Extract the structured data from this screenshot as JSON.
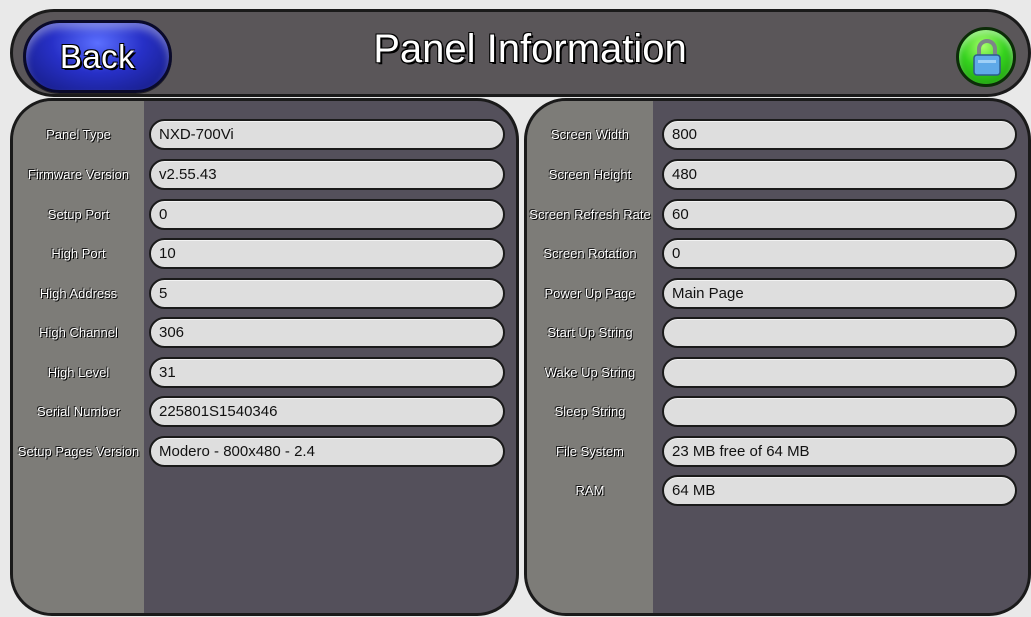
{
  "header": {
    "back_label": "Back",
    "title": "Panel Information",
    "lock_icon": "lock-icon"
  },
  "left_panel": {
    "rows": [
      {
        "label": "Panel Type",
        "value": "NXD-700Vi"
      },
      {
        "label": "Firmware Version",
        "value": "v2.55.43"
      },
      {
        "label": "Setup Port",
        "value": "0"
      },
      {
        "label": "High Port",
        "value": "10"
      },
      {
        "label": "High Address",
        "value": "5"
      },
      {
        "label": "High Channel",
        "value": "306"
      },
      {
        "label": "High Level",
        "value": "31"
      },
      {
        "label": "Serial Number",
        "value": "225801S1540346"
      },
      {
        "label": "Setup Pages Version",
        "value": "Modero - 800x480 - 2.4"
      }
    ]
  },
  "right_panel": {
    "rows": [
      {
        "label": "Screen Width",
        "value": "800"
      },
      {
        "label": "Screen Height",
        "value": "480"
      },
      {
        "label": "Screen Refresh Rate",
        "value": "60"
      },
      {
        "label": "Screen Rotation",
        "value": "0"
      },
      {
        "label": "Power Up Page",
        "value": "Main Page"
      },
      {
        "label": "Start Up String",
        "value": ""
      },
      {
        "label": "Wake Up String",
        "value": ""
      },
      {
        "label": "Sleep String",
        "value": ""
      },
      {
        "label": "File System",
        "value": "23 MB free of 64 MB"
      },
      {
        "label": "RAM",
        "value": "64 MB"
      }
    ]
  },
  "colors": {
    "back_button": "#2730c7",
    "lock_button": "#35d21e",
    "header_bg": "#5a5659",
    "panel_bg": "#54505b",
    "label_col_bg": "#7d7c78",
    "field_bg": "#dedede"
  }
}
